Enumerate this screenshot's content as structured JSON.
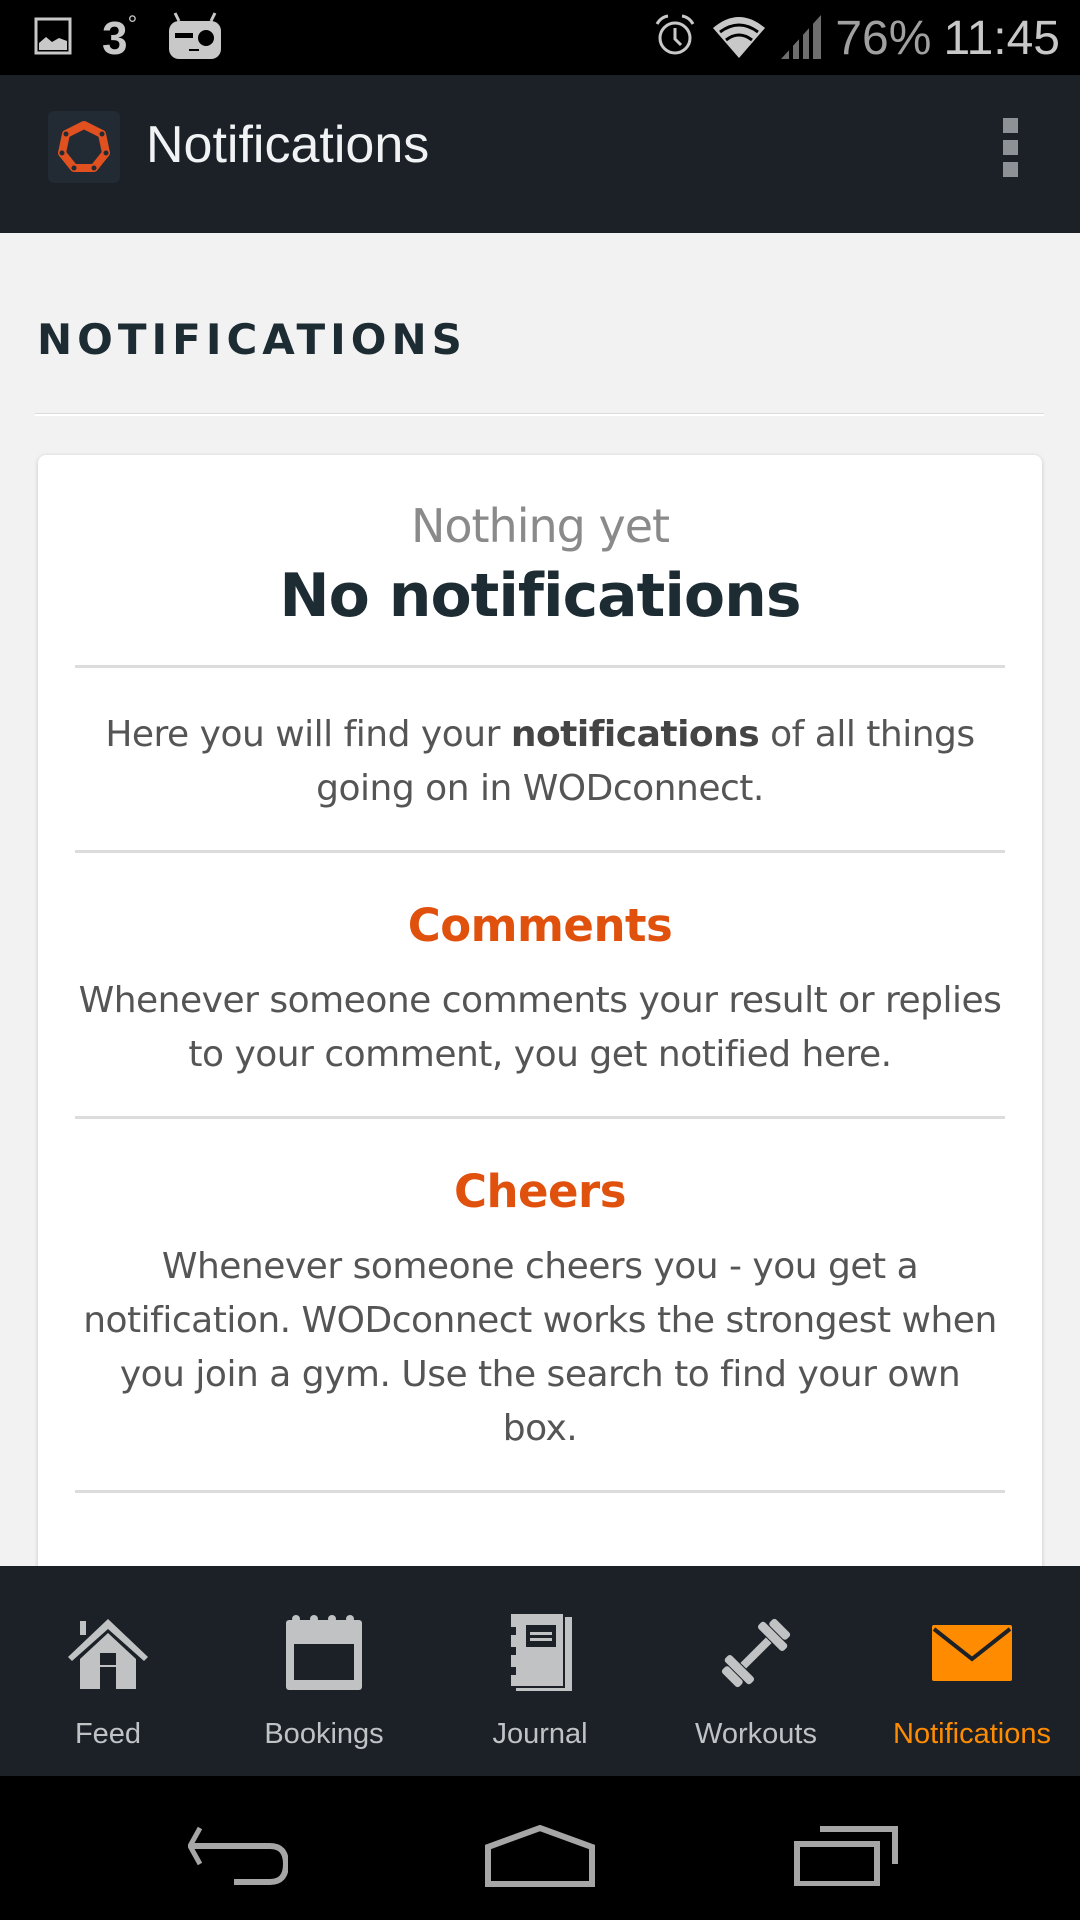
{
  "status_bar": {
    "left_icons": [
      "gallery-icon",
      "weather-icon",
      "cyanogenmod-icon"
    ],
    "temperature": "3",
    "temperature_unit": "°",
    "right_icons": [
      "alarm-icon",
      "wifi-icon",
      "signal-icon"
    ],
    "battery": "76%",
    "time": "11:45"
  },
  "app_bar": {
    "title": "Notifications",
    "logo_icon": "wodconnect-logo",
    "menu_icon": "overflow-menu-icon"
  },
  "page": {
    "section_title": "NOTIFICATIONS",
    "empty_state": {
      "subtitle": "Nothing yet",
      "title": "No notifications",
      "intro_before": "Here you will find your ",
      "intro_bold": "notifications",
      "intro_after": " of all things going on in WODconnect."
    },
    "blocks": [
      {
        "heading": "Comments",
        "text": "Whenever someone comments your result or replies to your comment, you get notified here."
      },
      {
        "heading": "Cheers",
        "text": "Whenever someone cheers you - you get a notification. WODconnect works the strongest when you join a gym. Use the search to find your own box."
      }
    ]
  },
  "bottom_nav": {
    "items": [
      {
        "label": "Feed",
        "icon": "home-icon",
        "active": false
      },
      {
        "label": "Bookings",
        "icon": "calendar-icon",
        "active": false
      },
      {
        "label": "Journal",
        "icon": "journal-icon",
        "active": false
      },
      {
        "label": "Workouts",
        "icon": "dumbbell-icon",
        "active": false
      },
      {
        "label": "Notifications",
        "icon": "envelope-icon",
        "active": true
      }
    ]
  },
  "system_nav": {
    "buttons": [
      "back-icon",
      "home-icon",
      "recents-icon"
    ]
  },
  "colors": {
    "brand_orange": "#e0510e",
    "active_tab": "#ff8c00",
    "app_bar_bg": "#1b2127",
    "heading_dark": "#1d2b33"
  }
}
